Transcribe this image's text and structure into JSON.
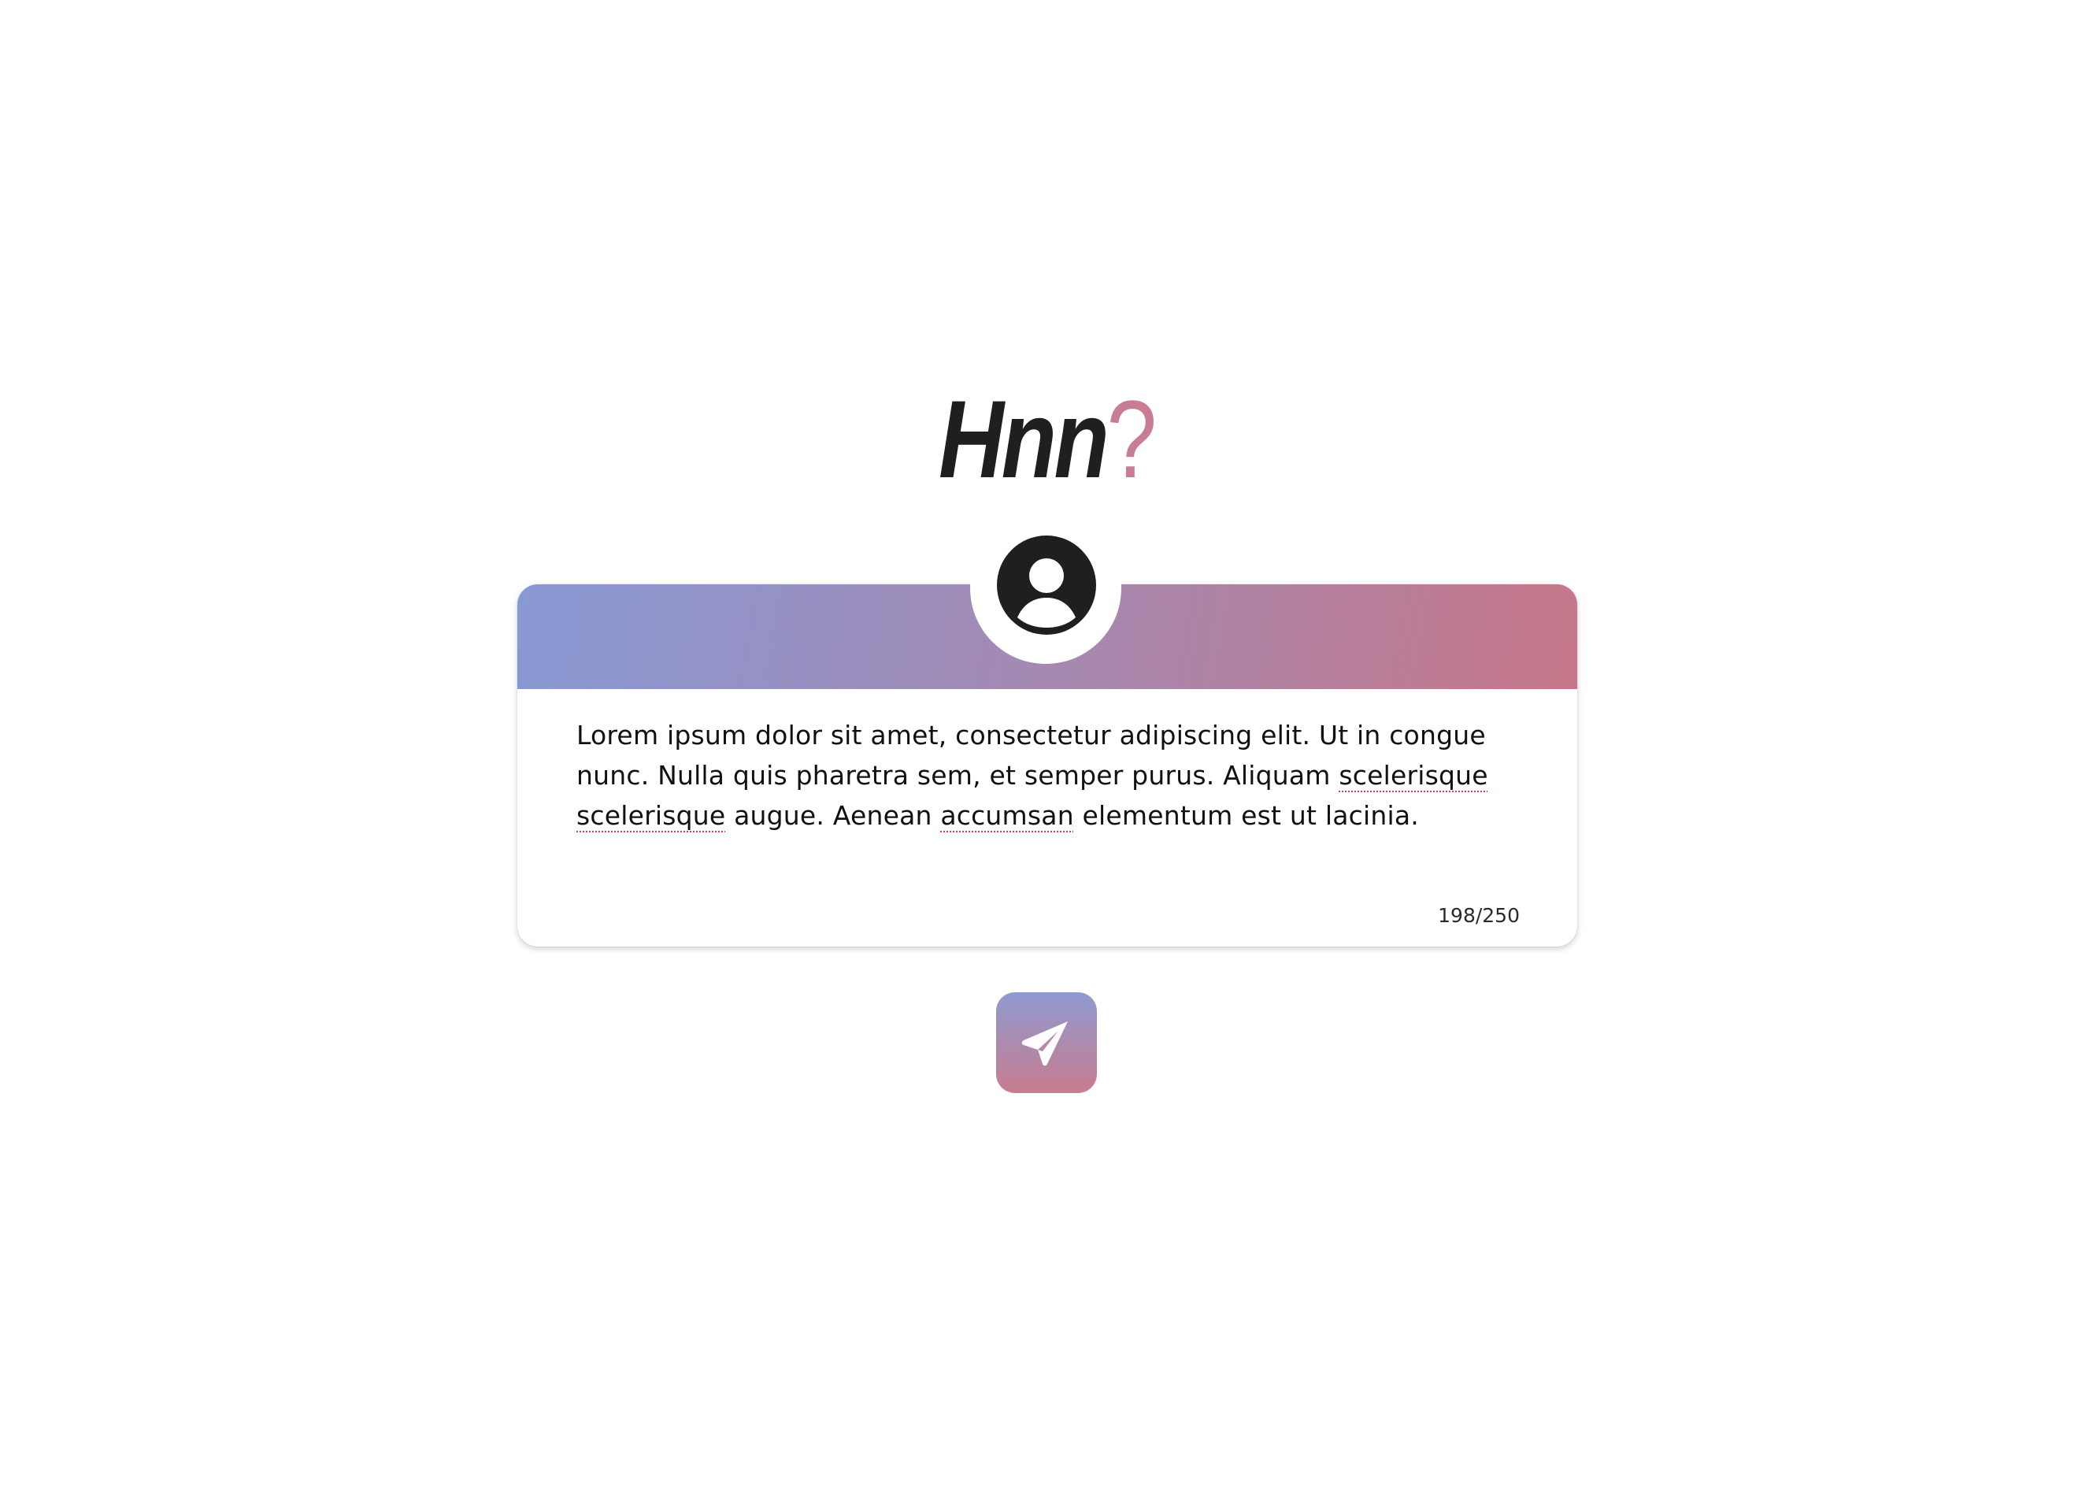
{
  "app": {
    "logo_text": "Hnn",
    "logo_mark": "?"
  },
  "composer": {
    "avatar_icon": "user-circle-icon",
    "message_parts": {
      "p1": "Lorem ipsum dolor sit amet, consectetur adipiscing elit. Ut in congue nunc. Nulla quis pharetra sem, et semper purus. Aliquam ",
      "w1": "scelerisque",
      "p2": " ",
      "w2": "scelerisque",
      "p3": " augue. Aenean ",
      "w3": "accumsan",
      "p4": " elementum est ut lacinia."
    },
    "counter": "198/250"
  },
  "send_button": {
    "icon": "paper-plane-icon"
  },
  "colors": {
    "gradient_start": "#8899d4",
    "gradient_end": "#c67789",
    "logo_mark": "#c97d92",
    "text": "#111111"
  }
}
